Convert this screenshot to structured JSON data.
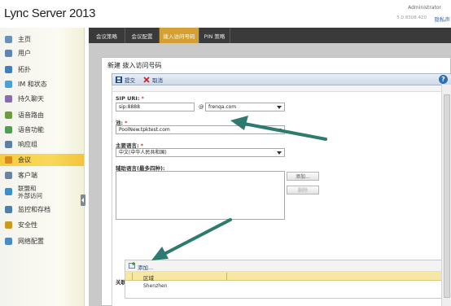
{
  "header": {
    "app_title": "Lync Server 2013",
    "user": "Administrator",
    "version": "5.0.8308.420",
    "help_link": "隐私声"
  },
  "sidebar": {
    "items": [
      {
        "label": "主页",
        "icon": "home-icon",
        "color": "#6a8fb8"
      },
      {
        "label": "用户",
        "icon": "users-icon",
        "color": "#5b86b5"
      },
      {
        "label": "拓扑",
        "icon": "topology-icon",
        "color": "#3f7fbf"
      },
      {
        "label": "IM 和状态",
        "icon": "im-presence-icon",
        "color": "#4aa0d8"
      },
      {
        "label": "持久聊天",
        "icon": "persistent-chat-icon",
        "color": "#8a6ab0"
      },
      {
        "label": "语音路由",
        "icon": "voice-routing-icon",
        "color": "#6b9d3e"
      },
      {
        "label": "语音功能",
        "icon": "voice-features-icon",
        "color": "#4e9e52"
      },
      {
        "label": "响应组",
        "icon": "response-group-icon",
        "color": "#5a7fa8"
      },
      {
        "label": "会议",
        "icon": "conferencing-icon",
        "color": "#d88a1e"
      },
      {
        "label": "客户端",
        "icon": "clients-icon",
        "color": "#6b82a3"
      },
      {
        "label": "联盟和\n外部访问",
        "icon": "federation-icon",
        "color": "#3d8fc9"
      },
      {
        "label": "监控和存档",
        "icon": "monitoring-icon",
        "color": "#4b7fae"
      },
      {
        "label": "安全性",
        "icon": "security-icon",
        "color": "#c99a1f"
      },
      {
        "label": "网络配置",
        "icon": "network-icon",
        "color": "#4a8bc3"
      }
    ],
    "selected_index": 8
  },
  "tabs": [
    {
      "label": "会议策略"
    },
    {
      "label": "会议配置"
    },
    {
      "label": "拨入访问号码",
      "active": true
    },
    {
      "label": "PIN 策略"
    }
  ],
  "panel": {
    "title": "新建 拨入访问号码",
    "toolbar": {
      "commit_label": "提交",
      "cancel_label": "取消"
    },
    "sip_uri": {
      "label": "SIP URI:",
      "user_value": "sip:8888",
      "at": "@",
      "domain_value": "frenqa.com"
    },
    "pool": {
      "label": "池:",
      "value": "PoolNew.tpktest.com"
    },
    "primary_language": {
      "label": "主要语言:",
      "value": "中文(中华人民共和国)"
    },
    "secondary_languages": {
      "label": "辅助语言(最多四种):",
      "add_label": "添加...",
      "remove_label": "删除"
    },
    "regions": {
      "label": "关联区域",
      "add_label": "添加...",
      "column_header": "区域",
      "rows": [
        "Shenzhen"
      ]
    }
  },
  "colors": {
    "accent_tab": "#d4a034",
    "selected_sidebar": "#f6cc3e",
    "arrow": "#2e7a6e"
  }
}
